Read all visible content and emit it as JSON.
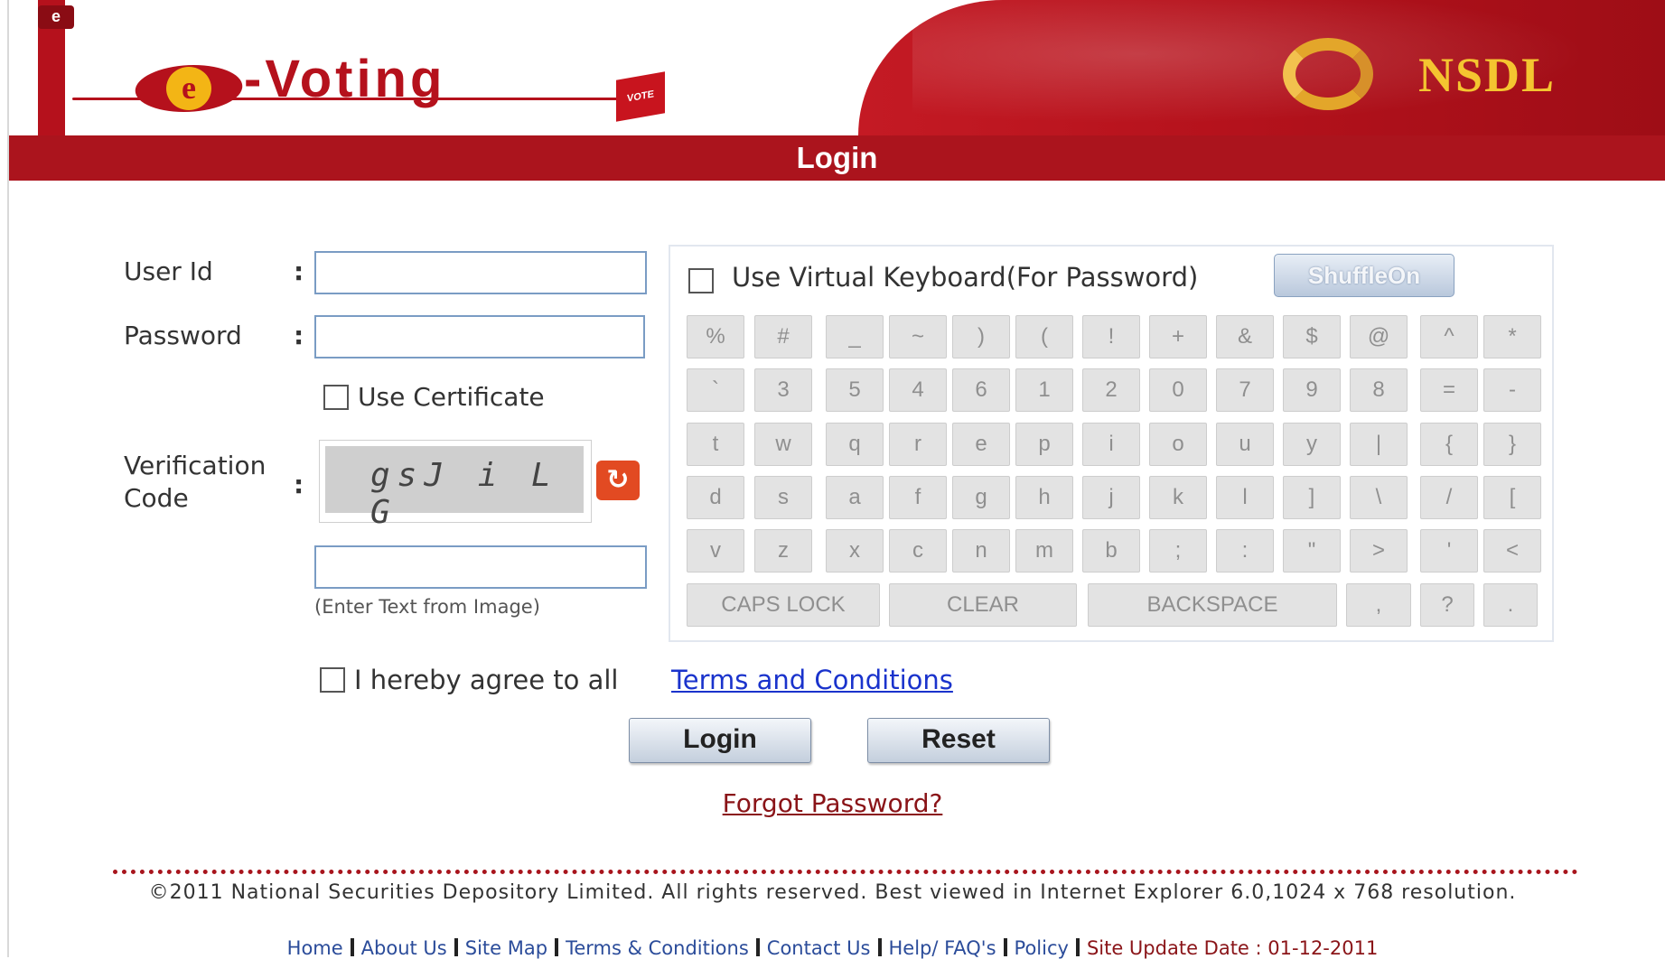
{
  "header": {
    "logo_text": "e-Voting",
    "logo_e": "e",
    "ballot_label": "VOTE",
    "brand": "NSDL",
    "page_title": "Login"
  },
  "form": {
    "user_id_label": "User Id",
    "password_label": "Password",
    "colon": ":",
    "use_certificate_label": "Use Certificate",
    "verification_label_line1": "Verification",
    "verification_label_line2": "Code",
    "captcha_text": "gsJ i L G",
    "captcha_hint": "(Enter Text from Image)",
    "refresh_icon": "refresh-icon",
    "agree_text": "I hereby agree to all",
    "terms_link": "Terms and Conditions",
    "login_button": "Login",
    "reset_button": "Reset",
    "forgot_password": "Forgot Password?"
  },
  "virtual_keyboard": {
    "toggle_label": "Use Virtual Keyboard(For Password)",
    "shuffle_button": "ShuffleOn",
    "rows": [
      [
        "%",
        "#",
        "_",
        "~",
        ")",
        "(",
        "!",
        "+",
        "&",
        "$",
        "@",
        "^",
        "*"
      ],
      [
        "`",
        "3",
        "5",
        "4",
        "6",
        "1",
        "2",
        "0",
        "7",
        "9",
        "8",
        "=",
        "-"
      ],
      [
        "t",
        "w",
        "q",
        "r",
        "e",
        "p",
        "i",
        "o",
        "u",
        "y",
        "|",
        "{",
        "}"
      ],
      [
        "d",
        "s",
        "a",
        "f",
        "g",
        "h",
        "j",
        "k",
        "l",
        "]",
        "\\",
        "/",
        "["
      ],
      [
        "v",
        "z",
        "x",
        "c",
        "n",
        "m",
        "b",
        ";",
        ":",
        "\"",
        ">",
        "'",
        "<"
      ]
    ],
    "bottom_row": [
      "CAPS LOCK",
      "CLEAR",
      "BACKSPACE",
      ",",
      "?",
      "."
    ]
  },
  "footer": {
    "copyright": "©2011 National Securities Depository Limited. All rights reserved. Best viewed in Internet Explorer 6.0,1024 x 768 resolution.",
    "links": [
      "Home",
      "About Us",
      "Site Map",
      "Terms & Conditions",
      "Contact Us",
      "Help/ FAQ's",
      "Policy"
    ],
    "site_update": "Site Update Date : 01-12-2011"
  },
  "colors": {
    "brand_red": "#ab141d",
    "brand_gold": "#f4c530",
    "link_blue": "#1a33cc"
  }
}
